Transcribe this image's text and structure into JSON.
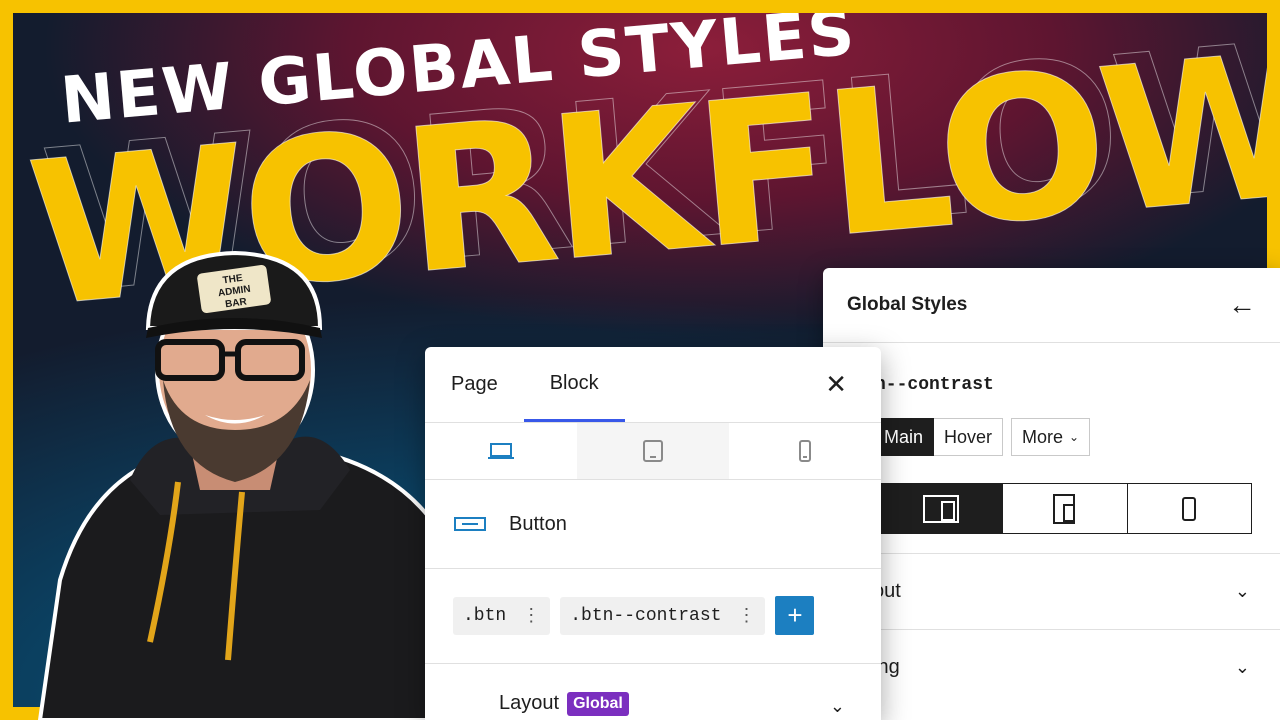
{
  "headline": {
    "top_line": "NEW GLOBAL STYLES",
    "main_word": "WORKFLOW"
  },
  "cap_logo": {
    "line1": "THE",
    "line2": "ADMIN",
    "line3": "BAR"
  },
  "global_styles_panel": {
    "title": "Global Styles",
    "back_icon": "arrow-left-icon",
    "class_name": "n--contrast",
    "states": {
      "main": "Main",
      "hover": "Hover",
      "more": "More"
    },
    "devices": [
      "desktop-icon",
      "tablet-icon",
      "mobile-icon"
    ],
    "sections": [
      "out",
      "ing"
    ]
  },
  "block_panel": {
    "tabs": [
      "Page",
      "Block"
    ],
    "active_tab": "Block",
    "close_icon": "close-icon",
    "devices": [
      "desktop-icon",
      "tablet-icon",
      "mobile-icon"
    ],
    "block_name": "Button",
    "classes": [
      ".btn",
      ".btn--contrast"
    ],
    "add_label": "+",
    "layout_label": "Layout",
    "layout_badge": "Global"
  },
  "colors": {
    "frame": "#f7c200",
    "accent_blue": "#1c7fc1",
    "tab_underline": "#3858e9",
    "badge_purple": "#7b2fbf"
  }
}
